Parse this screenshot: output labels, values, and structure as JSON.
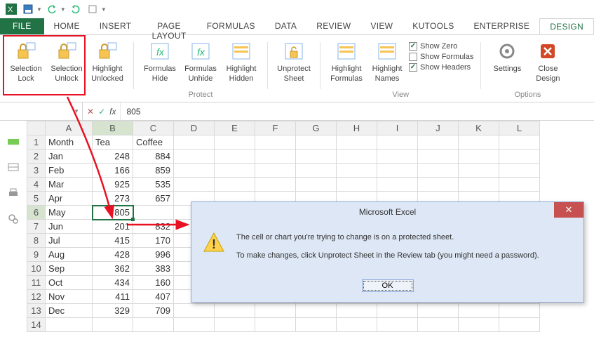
{
  "qat": {
    "icons": [
      "excel",
      "save",
      "undo",
      "redo",
      "mode"
    ]
  },
  "tabs": [
    "FILE",
    "HOME",
    "INSERT",
    "PAGE LAYOUT",
    "FORMULAS",
    "DATA",
    "REVIEW",
    "VIEW",
    "KUTOOLS",
    "ENTERPRISE",
    "DESIGN"
  ],
  "activeTab": "DESIGN",
  "ribbon": {
    "groups": [
      {
        "label": "",
        "buttons": [
          {
            "name": "selection-lock",
            "line1": "Selection",
            "line2": "Lock"
          },
          {
            "name": "selection-unlock",
            "line1": "Selection",
            "line2": "Unlock"
          },
          {
            "name": "highlight-unlocked",
            "line1": "Highlight",
            "line2": "Unlocked"
          }
        ]
      },
      {
        "label": "Protect",
        "buttons": [
          {
            "name": "formulas-hide",
            "line1": "Formulas",
            "line2": "Hide"
          },
          {
            "name": "formulas-unhide",
            "line1": "Formulas",
            "line2": "Unhide"
          },
          {
            "name": "highlight-hidden",
            "line1": "Highlight",
            "line2": "Hidden"
          }
        ]
      },
      {
        "label": "",
        "buttons": [
          {
            "name": "unprotect-sheet",
            "line1": "Unprotect",
            "line2": "Sheet"
          }
        ]
      },
      {
        "label": "View",
        "buttons": [
          {
            "name": "highlight-formulas",
            "line1": "Highlight",
            "line2": "Formulas"
          },
          {
            "name": "highlight-names",
            "line1": "Highlight",
            "line2": "Names"
          }
        ],
        "checks": [
          {
            "label": "Show Zero",
            "checked": true
          },
          {
            "label": "Show Formulas",
            "checked": false
          },
          {
            "label": "Show Headers",
            "checked": true
          }
        ]
      },
      {
        "label": "Options",
        "buttons": [
          {
            "name": "settings",
            "line1": "Settings",
            "line2": ""
          },
          {
            "name": "close-design",
            "line1": "Close",
            "line2": "Design"
          }
        ]
      }
    ]
  },
  "nameBox": "",
  "formula": "805",
  "cols": [
    "A",
    "B",
    "C",
    "D",
    "E",
    "F",
    "G",
    "H",
    "I",
    "J",
    "K",
    "L"
  ],
  "rows": [
    {
      "n": 1,
      "A": "Month",
      "B": "Tea",
      "C": "Coffee"
    },
    {
      "n": 2,
      "A": "Jan",
      "B": "248",
      "C": "884"
    },
    {
      "n": 3,
      "A": "Feb",
      "B": "166",
      "C": "859"
    },
    {
      "n": 4,
      "A": "Mar",
      "B": "925",
      "C": "535"
    },
    {
      "n": 5,
      "A": "Apr",
      "B": "273",
      "C": "657"
    },
    {
      "n": 6,
      "A": "May",
      "B": "805",
      "C": ""
    },
    {
      "n": 7,
      "A": "Jun",
      "B": "201",
      "C": "832"
    },
    {
      "n": 8,
      "A": "Jul",
      "B": "415",
      "C": "170"
    },
    {
      "n": 9,
      "A": "Aug",
      "B": "428",
      "C": "996"
    },
    {
      "n": 10,
      "A": "Sep",
      "B": "362",
      "C": "383"
    },
    {
      "n": 11,
      "A": "Oct",
      "B": "434",
      "C": "160"
    },
    {
      "n": 12,
      "A": "Nov",
      "B": "411",
      "C": "407"
    },
    {
      "n": 13,
      "A": "Dec",
      "B": "329",
      "C": "709"
    },
    {
      "n": 14,
      "A": "",
      "B": "",
      "C": ""
    }
  ],
  "activeRow": 6,
  "activeCol": "B",
  "dialog": {
    "title": "Microsoft Excel",
    "line1": "The cell or chart you're trying to change is on a protected sheet.",
    "line2": "To make changes, click Unprotect Sheet in the Review tab (you might need a password).",
    "ok": "OK"
  }
}
